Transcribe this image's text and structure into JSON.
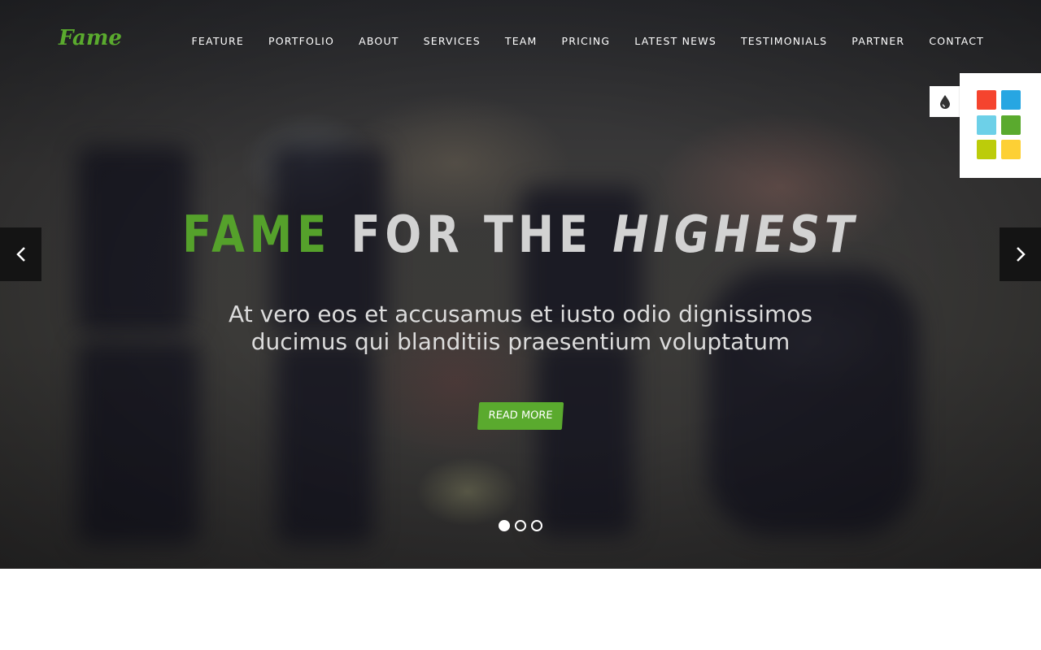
{
  "brand": {
    "logo": "Fame",
    "accent_color": "#5aaa2e"
  },
  "nav": {
    "items": [
      {
        "label": "FEATURE"
      },
      {
        "label": "PORTFOLIO"
      },
      {
        "label": "ABOUT"
      },
      {
        "label": "SERVICES"
      },
      {
        "label": "TEAM"
      },
      {
        "label": "PRICING"
      },
      {
        "label": "LATEST NEWS"
      },
      {
        "label": "TESTIMONIALS"
      },
      {
        "label": "PARTNER"
      },
      {
        "label": "CONTACT"
      }
    ]
  },
  "hero": {
    "headline_accent": "FAME",
    "headline_mid": "FOR THE",
    "headline_italic": "HIGHEST",
    "subtitle_line1": "At vero eos et accusamus et iusto odio dignissimos",
    "subtitle_line2": "ducimus qui blanditiis praesentium voluptatum",
    "cta_label": "READ MORE",
    "slides_total": 3,
    "active_slide": 1,
    "prev_icon": "chevron-left-icon",
    "next_icon": "chevron-right-icon"
  },
  "style_switcher": {
    "toggle_icon": "droplet-icon",
    "swatches": [
      "#f5442e",
      "#27a6e2",
      "#6dd0e8",
      "#5aaa2e",
      "#bccc0a",
      "#fdd035"
    ]
  }
}
